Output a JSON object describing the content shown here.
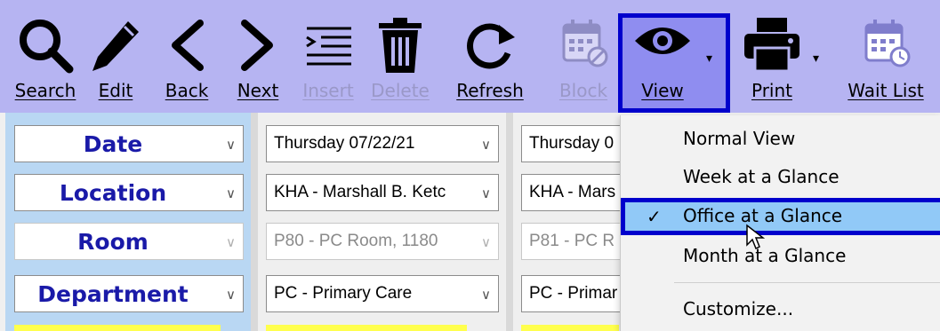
{
  "toolbar": {
    "buttons": [
      {
        "label": "Search",
        "icon": "search-icon",
        "enabled": true
      },
      {
        "label": "Edit",
        "icon": "pencil-icon",
        "enabled": true
      },
      {
        "label": "Back",
        "icon": "chevron-left-icon",
        "enabled": true
      },
      {
        "label": "Next",
        "icon": "chevron-right-icon",
        "enabled": true
      },
      {
        "label": "Insert",
        "icon": "insert-lines-icon",
        "enabled": false
      },
      {
        "label": "Delete",
        "icon": "trash-icon",
        "enabled": false
      },
      {
        "label": "Refresh",
        "icon": "refresh-icon",
        "enabled": true
      },
      {
        "label": "Block",
        "icon": "calendar-block-icon",
        "enabled": false
      },
      {
        "label": "View",
        "icon": "eye-icon",
        "enabled": true,
        "active": true
      },
      {
        "label": "Print",
        "icon": "printer-icon",
        "enabled": true
      },
      {
        "label": "Wait List",
        "icon": "calendar-clock-icon",
        "enabled": true
      }
    ]
  },
  "filters": {
    "labels": [
      "Date",
      "Location",
      "Room",
      "Department"
    ],
    "column_a": [
      "Thursday 07/22/21",
      "KHA - Marshall B. Ketc",
      "P80 - PC Room, 1180",
      "PC - Primary Care"
    ],
    "column_b": [
      "Thursday 0",
      "KHA - Mars",
      "P81 - PC R",
      "PC - Primar"
    ]
  },
  "view_menu": {
    "items": [
      {
        "label": "Normal View",
        "checked": false
      },
      {
        "label": "Week at a Glance",
        "checked": false
      },
      {
        "label": "Office at a Glance",
        "checked": true
      },
      {
        "label": "Month at a Glance",
        "checked": false
      },
      {
        "label": "Customize...",
        "checked": false
      }
    ]
  },
  "colors": {
    "toolbar_bg": "#b6b4f2",
    "highlight_border": "#0000cc",
    "selected_item_bg": "#91c9f7",
    "label_text": "#1a1aa8",
    "label_column_bg": "#b9d7f3"
  }
}
